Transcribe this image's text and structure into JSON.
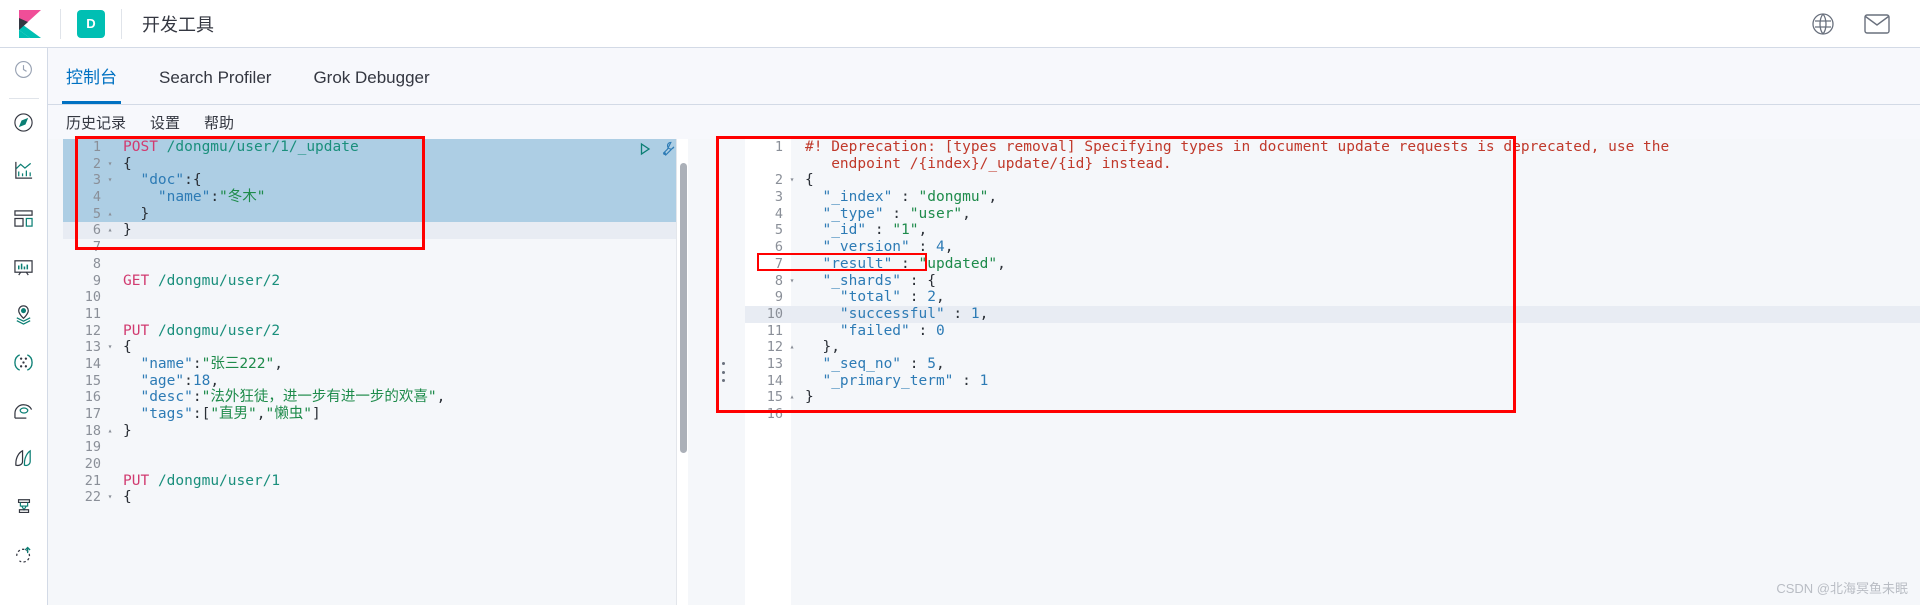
{
  "header": {
    "logo_icon": "kibana-logo-icon",
    "space_badge": "D",
    "title": "开发工具",
    "help_icon": "help-circle-icon",
    "mail_icon": "mail-icon"
  },
  "rail": {
    "items": [
      {
        "name": "recently-viewed",
        "icon": "clock-icon"
      },
      {
        "name": "discover",
        "icon": "compass-icon"
      },
      {
        "name": "visualize",
        "icon": "bar-chart-icon"
      },
      {
        "name": "dashboard",
        "icon": "dashboard-icon"
      },
      {
        "name": "canvas",
        "icon": "presentation-icon"
      },
      {
        "name": "maps",
        "icon": "map-marker-layers-icon"
      },
      {
        "name": "machine-learning",
        "icon": "graph-nodes-icon"
      },
      {
        "name": "infrastructure",
        "icon": "infrastructure-icon"
      },
      {
        "name": "logs",
        "icon": "logs-icon"
      },
      {
        "name": "apm",
        "icon": "apm-icon"
      },
      {
        "name": "uptime",
        "icon": "uptime-icon"
      }
    ]
  },
  "tabs": [
    {
      "label": "控制台",
      "active": true
    },
    {
      "label": "Search Profiler",
      "active": false
    },
    {
      "label": "Grok Debugger",
      "active": false
    }
  ],
  "console_menu": [
    {
      "label": "历史记录"
    },
    {
      "label": "设置"
    },
    {
      "label": "帮助"
    }
  ],
  "request_editor": {
    "actions": {
      "play_icon": "play-triangle-icon",
      "wrench_icon": "wrench-icon"
    },
    "lines": [
      {
        "n": "1",
        "fold": "",
        "state": "sel",
        "tokens": [
          [
            "m-post",
            "POST"
          ],
          [
            "p",
            " "
          ],
          [
            "url",
            "/dongmu/user/1/_update"
          ]
        ]
      },
      {
        "n": "2",
        "fold": "▾",
        "state": "sel",
        "tokens": [
          [
            "p",
            "{"
          ]
        ]
      },
      {
        "n": "3",
        "fold": "▾",
        "state": "sel",
        "tokens": [
          [
            "p",
            "  "
          ],
          [
            "k",
            "\"doc\""
          ],
          [
            "p",
            ":{"
          ]
        ]
      },
      {
        "n": "4",
        "fold": "",
        "state": "sel",
        "tokens": [
          [
            "p",
            "    "
          ],
          [
            "k",
            "\"name\""
          ],
          [
            "p",
            ":"
          ],
          [
            "s",
            "\"冬木\""
          ]
        ]
      },
      {
        "n": "5",
        "fold": "▴",
        "state": "sel",
        "tokens": [
          [
            "p",
            "  }"
          ]
        ]
      },
      {
        "n": "6",
        "fold": "▴",
        "state": "active",
        "tokens": [
          [
            "p",
            "}"
          ]
        ]
      },
      {
        "n": "7",
        "fold": "",
        "state": "",
        "tokens": []
      },
      {
        "n": "8",
        "fold": "",
        "state": "",
        "tokens": []
      },
      {
        "n": "9",
        "fold": "",
        "state": "",
        "tokens": [
          [
            "m-get",
            "GET"
          ],
          [
            "p",
            " "
          ],
          [
            "url",
            "/dongmu/user/2"
          ]
        ]
      },
      {
        "n": "10",
        "fold": "",
        "state": "",
        "tokens": []
      },
      {
        "n": "11",
        "fold": "",
        "state": "",
        "tokens": []
      },
      {
        "n": "12",
        "fold": "",
        "state": "",
        "tokens": [
          [
            "m-put",
            "PUT"
          ],
          [
            "p",
            " "
          ],
          [
            "url",
            "/dongmu/user/2"
          ]
        ]
      },
      {
        "n": "13",
        "fold": "▾",
        "state": "",
        "tokens": [
          [
            "p",
            "{"
          ]
        ]
      },
      {
        "n": "14",
        "fold": "",
        "state": "",
        "tokens": [
          [
            "p",
            "  "
          ],
          [
            "k",
            "\"name\""
          ],
          [
            "p",
            ":"
          ],
          [
            "s",
            "\"张三222\""
          ],
          [
            "p",
            ","
          ]
        ]
      },
      {
        "n": "15",
        "fold": "",
        "state": "",
        "tokens": [
          [
            "p",
            "  "
          ],
          [
            "k",
            "\"age\""
          ],
          [
            "p",
            ":"
          ],
          [
            "n",
            "18"
          ],
          [
            "p",
            ","
          ]
        ]
      },
      {
        "n": "16",
        "fold": "",
        "state": "",
        "tokens": [
          [
            "p",
            "  "
          ],
          [
            "k",
            "\"desc\""
          ],
          [
            "p",
            ":"
          ],
          [
            "s",
            "\"法外狂徒，进一步有进一步的欢喜\""
          ],
          [
            "p",
            ","
          ]
        ]
      },
      {
        "n": "17",
        "fold": "",
        "state": "",
        "tokens": [
          [
            "p",
            "  "
          ],
          [
            "k",
            "\"tags\""
          ],
          [
            "p",
            ":["
          ],
          [
            "s",
            "\"直男\""
          ],
          [
            "p",
            ","
          ],
          [
            "s",
            "\"懒虫\""
          ],
          [
            "p",
            "]"
          ]
        ]
      },
      {
        "n": "18",
        "fold": "▴",
        "state": "",
        "tokens": [
          [
            "p",
            "}"
          ]
        ]
      },
      {
        "n": "19",
        "fold": "",
        "state": "",
        "tokens": []
      },
      {
        "n": "20",
        "fold": "",
        "state": "",
        "tokens": []
      },
      {
        "n": "21",
        "fold": "",
        "state": "",
        "tokens": [
          [
            "m-put",
            "PUT"
          ],
          [
            "p",
            " "
          ],
          [
            "url",
            "/dongmu/user/1"
          ]
        ]
      },
      {
        "n": "22",
        "fold": "▾",
        "state": "",
        "tokens": [
          [
            "p",
            "{"
          ]
        ]
      }
    ]
  },
  "response_editor": {
    "lines": [
      {
        "n": "1",
        "fold": "",
        "state": "",
        "tokens": [
          [
            "warn",
            "#! Deprecation: [types removal] Specifying types in document update requests is deprecated, use the"
          ]
        ]
      },
      {
        "n": "",
        "fold": "",
        "state": "",
        "tokens": [
          [
            "warn",
            "   endpoint /{index}/_update/{id} instead."
          ]
        ]
      },
      {
        "n": "2",
        "fold": "▾",
        "state": "",
        "tokens": [
          [
            "p",
            "{"
          ]
        ]
      },
      {
        "n": "3",
        "fold": "",
        "state": "",
        "tokens": [
          [
            "p",
            "  "
          ],
          [
            "k",
            "\"_index\""
          ],
          [
            "p",
            " : "
          ],
          [
            "s",
            "\"dongmu\""
          ],
          [
            "p",
            ","
          ]
        ]
      },
      {
        "n": "4",
        "fold": "",
        "state": "",
        "tokens": [
          [
            "p",
            "  "
          ],
          [
            "k",
            "\"_type\""
          ],
          [
            "p",
            " : "
          ],
          [
            "s",
            "\"user\""
          ],
          [
            "p",
            ","
          ]
        ]
      },
      {
        "n": "5",
        "fold": "",
        "state": "",
        "tokens": [
          [
            "p",
            "  "
          ],
          [
            "k",
            "\"_id\""
          ],
          [
            "p",
            " : "
          ],
          [
            "s",
            "\"1\""
          ],
          [
            "p",
            ","
          ]
        ]
      },
      {
        "n": "6",
        "fold": "",
        "state": "",
        "tokens": [
          [
            "p",
            "  "
          ],
          [
            "k",
            "\"_version\""
          ],
          [
            "p",
            " : "
          ],
          [
            "n",
            "4"
          ],
          [
            "p",
            ","
          ]
        ]
      },
      {
        "n": "7",
        "fold": "",
        "state": "",
        "tokens": [
          [
            "p",
            "  "
          ],
          [
            "k",
            "\"result\""
          ],
          [
            "p",
            " : "
          ],
          [
            "s",
            "\"updated\""
          ],
          [
            "p",
            ","
          ]
        ]
      },
      {
        "n": "8",
        "fold": "▾",
        "state": "",
        "tokens": [
          [
            "p",
            "  "
          ],
          [
            "k",
            "\"_shards\""
          ],
          [
            "p",
            " : {"
          ]
        ]
      },
      {
        "n": "9",
        "fold": "",
        "state": "",
        "tokens": [
          [
            "p",
            "    "
          ],
          [
            "k",
            "\"total\""
          ],
          [
            "p",
            " : "
          ],
          [
            "n",
            "2"
          ],
          [
            "p",
            ","
          ]
        ]
      },
      {
        "n": "10",
        "fold": "",
        "state": "active",
        "tokens": [
          [
            "p",
            "    "
          ],
          [
            "k",
            "\"successful\""
          ],
          [
            "p",
            " : "
          ],
          [
            "n",
            "1"
          ],
          [
            "p",
            ","
          ]
        ]
      },
      {
        "n": "11",
        "fold": "",
        "state": "",
        "tokens": [
          [
            "p",
            "    "
          ],
          [
            "k",
            "\"failed\""
          ],
          [
            "p",
            " : "
          ],
          [
            "n",
            "0"
          ]
        ]
      },
      {
        "n": "12",
        "fold": "▴",
        "state": "",
        "tokens": [
          [
            "p",
            "  },"
          ]
        ]
      },
      {
        "n": "13",
        "fold": "",
        "state": "",
        "tokens": [
          [
            "p",
            "  "
          ],
          [
            "k",
            "\"_seq_no\""
          ],
          [
            "p",
            " : "
          ],
          [
            "n",
            "5"
          ],
          [
            "p",
            ","
          ]
        ]
      },
      {
        "n": "14",
        "fold": "",
        "state": "",
        "tokens": [
          [
            "p",
            "  "
          ],
          [
            "k",
            "\"_primary_term\""
          ],
          [
            "p",
            " : "
          ],
          [
            "n",
            "1"
          ]
        ]
      },
      {
        "n": "15",
        "fold": "▴",
        "state": "",
        "tokens": [
          [
            "p",
            "}"
          ]
        ]
      },
      {
        "n": "16",
        "fold": "",
        "state": "",
        "tokens": []
      }
    ]
  },
  "annotations": {
    "request_box_color": "#FF0000",
    "response_box_color": "#FF0000",
    "result_box_color": "#FF0000"
  },
  "watermark": "CSDN @北海冥鱼未眠"
}
